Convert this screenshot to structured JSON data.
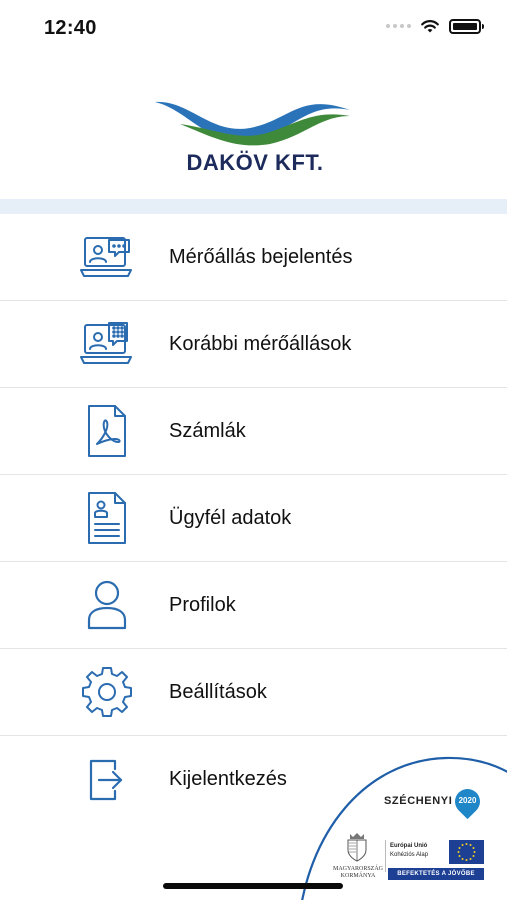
{
  "status_bar": {
    "time": "12:40",
    "icons": [
      "signal-icon",
      "wifi-icon",
      "battery-icon"
    ]
  },
  "logo": {
    "text": "DAKÖV KFT.",
    "colors": {
      "blue": "#2b73b8",
      "green": "#3f8a3a",
      "navy": "#1c2a5c"
    }
  },
  "menu": {
    "items": [
      {
        "label": "Mérőállás bejelentés",
        "icon": "meter-report-icon"
      },
      {
        "label": "Korábbi mérőállások",
        "icon": "meter-history-icon"
      },
      {
        "label": "Számlák",
        "icon": "invoice-pdf-icon"
      },
      {
        "label": "Ügyfél adatok",
        "icon": "customer-data-icon"
      },
      {
        "label": "Profilok",
        "icon": "profile-icon"
      },
      {
        "label": "Beállítások",
        "icon": "settings-gear-icon"
      },
      {
        "label": "Kijelentkezés",
        "icon": "logout-icon"
      }
    ]
  },
  "footer_badge": {
    "szechenyi": "SZÉCHENYI",
    "year": "2020",
    "government": "MAGYARORSZÁG KORMÁNYA",
    "eu_line1": "Európai Unió",
    "eu_line2": "Kohéziós Alap",
    "slogan": "BEFEKTETÉS A JÖVŐBE"
  },
  "accent_color": "#2b6cb0"
}
